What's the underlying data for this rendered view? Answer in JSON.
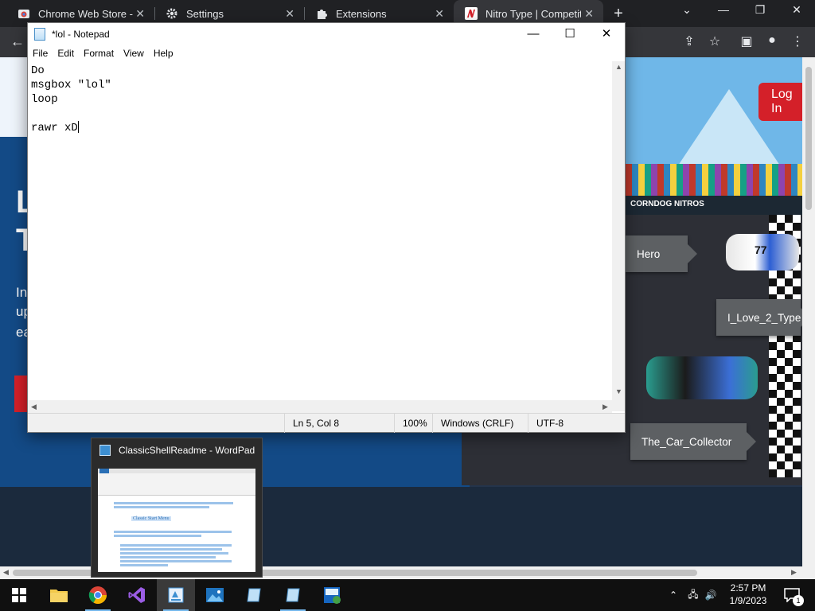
{
  "browser": {
    "tabs": [
      {
        "title": "Chrome Web Store - Ex",
        "icon": "chrome-web-store-icon"
      },
      {
        "title": "Settings",
        "icon": "gear-icon"
      },
      {
        "title": "Extensions",
        "icon": "puzzle-icon"
      },
      {
        "title": "Nitro Type | Competitiv",
        "icon": "nitro-type-icon"
      }
    ],
    "tab_close_glyph": "✕",
    "new_tab_glyph": "+",
    "window_controls": {
      "dropdown": "⌄",
      "minimize": "—",
      "restore": "❐",
      "close": "✕"
    },
    "toolbar": {
      "back": "←",
      "share": "⇪",
      "bookmark": "☆",
      "sidebar": "▣",
      "profile": "●",
      "menu": "⋮"
    }
  },
  "webpage": {
    "login_label": "Log In",
    "hero_big_1": "L",
    "hero_big_2": "T",
    "hero_small_1": "In",
    "hero_small_2": "up",
    "hero_small_3": "ea",
    "sponsor_text": "CORNDOG NITROS",
    "racers": [
      "Hero",
      "I_Love_2_Type",
      "The_Car_Collector"
    ],
    "car_number": "77"
  },
  "notepad": {
    "title": "*lol - Notepad",
    "menu": [
      "File",
      "Edit",
      "Format",
      "View",
      "Help"
    ],
    "lines": [
      "Do",
      "msgbox \"lol\"",
      "loop",
      "",
      "rawr xD"
    ],
    "status": {
      "position": "Ln 5, Col 8",
      "zoom": "100%",
      "line_ending": "Windows (CRLF)",
      "encoding": "UTF-8"
    },
    "controls": {
      "minimize": "—",
      "maximize": "☐",
      "close": "✕"
    }
  },
  "thumbnail": {
    "title": "ClassicShellReadme - WordPad",
    "heading": "Classic Start Menu"
  },
  "taskbar": {
    "apps": [
      {
        "name": "start-button",
        "icon": "windows-logo-icon"
      },
      {
        "name": "file-explorer",
        "icon": "folder-icon"
      },
      {
        "name": "chrome",
        "icon": "chrome-icon"
      },
      {
        "name": "visual-studio",
        "icon": "visual-studio-icon"
      },
      {
        "name": "wordpad",
        "icon": "wordpad-icon"
      },
      {
        "name": "photos",
        "icon": "photos-icon"
      },
      {
        "name": "notepad-a",
        "icon": "notepad-icon"
      },
      {
        "name": "notepad-b",
        "icon": "notepad-icon"
      },
      {
        "name": "classic-shell",
        "icon": "classic-shell-icon"
      }
    ],
    "tray": {
      "chevron": "⌃",
      "network": "🖧",
      "volume": "🔊"
    },
    "time": "2:57 PM",
    "date": "1/9/2023",
    "notification_count": "1"
  },
  "colors": {
    "chrome_dark": "#202124",
    "nitro_red": "#d42029",
    "page_blue": "#134a86",
    "taskbar": "#101010"
  }
}
